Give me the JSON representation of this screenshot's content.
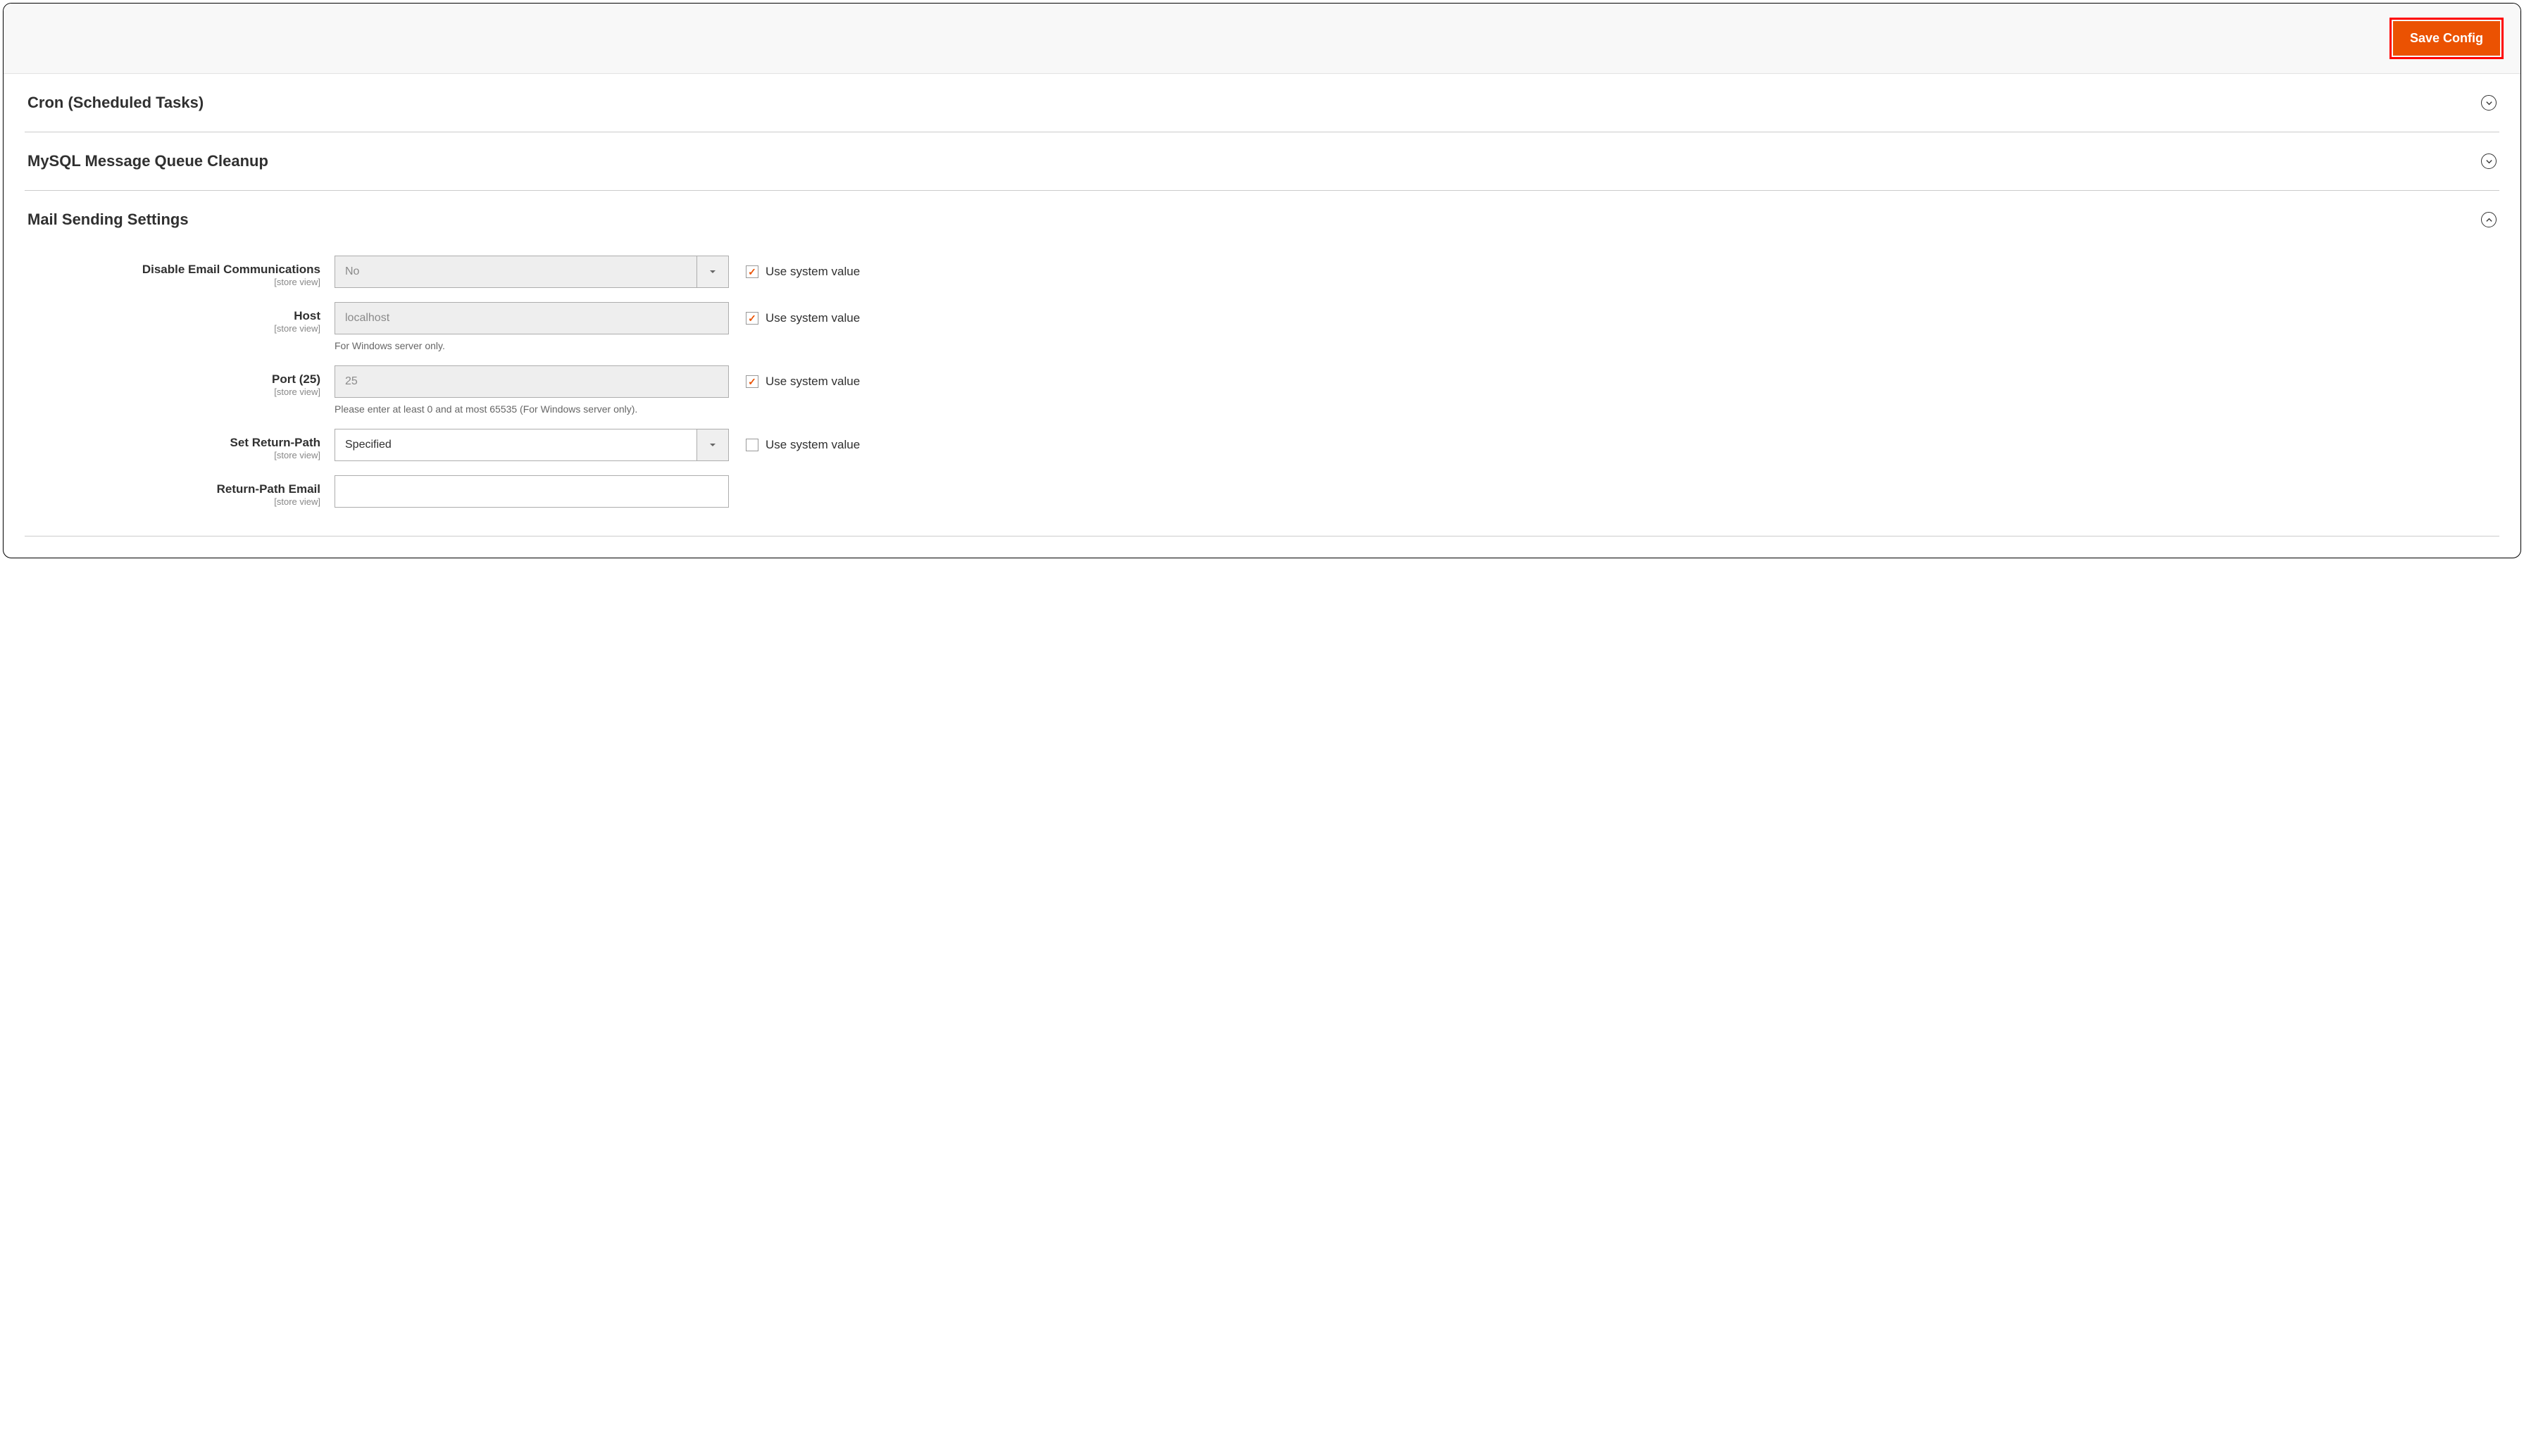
{
  "header": {
    "save_button": "Save Config"
  },
  "sections": {
    "cron": {
      "title": "Cron (Scheduled Tasks)"
    },
    "mysql": {
      "title": "MySQL Message Queue Cleanup"
    },
    "mail": {
      "title": "Mail Sending Settings"
    }
  },
  "scope_label": "[store view]",
  "use_system_value": "Use system value",
  "fields": {
    "disable_email": {
      "label": "Disable Email Communications",
      "value": "No"
    },
    "host": {
      "label": "Host",
      "placeholder": "localhost",
      "helper": "For Windows server only."
    },
    "port": {
      "label": "Port (25)",
      "placeholder": "25",
      "helper": "Please enter at least 0 and at most 65535 (For Windows server only)."
    },
    "return_path": {
      "label": "Set Return-Path",
      "value": "Specified"
    },
    "return_path_email": {
      "label": "Return-Path Email",
      "value": ""
    }
  }
}
